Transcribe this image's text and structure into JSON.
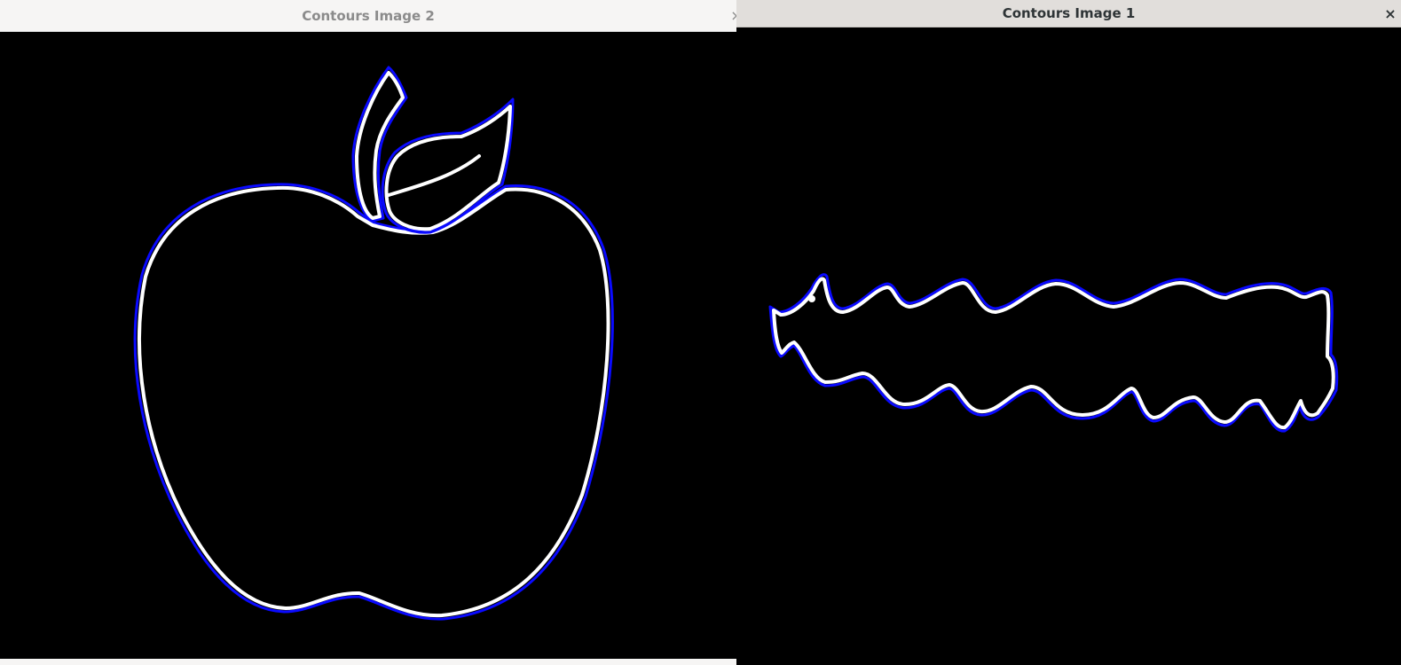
{
  "windows": {
    "left": {
      "title": "Contours Image 2",
      "close_glyph": "×",
      "icon": "close-icon"
    },
    "right": {
      "title": "Contours Image 1",
      "close_glyph": "×",
      "icon": "close-icon"
    }
  },
  "colors": {
    "contour_outer": "#0a0aff",
    "contour_inner": "#ffffff",
    "canvas_bg": "#000000"
  }
}
